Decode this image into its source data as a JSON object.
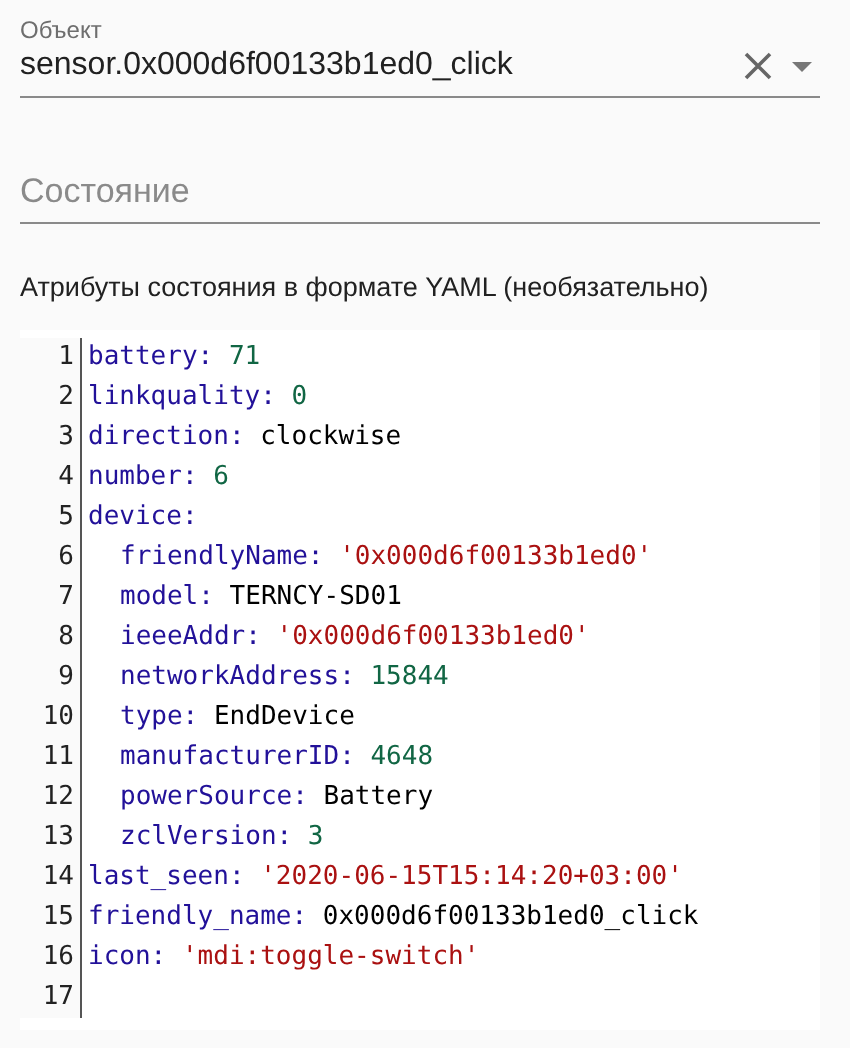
{
  "entity_field": {
    "label": "Объект",
    "value": "sensor.0x000d6f00133b1ed0_click"
  },
  "state_field": {
    "placeholder": "Состояние"
  },
  "attributes_label": "Атрибуты состояния в формате YAML (необязательно)",
  "yaml_editor": {
    "lines": [
      {
        "number": "1",
        "key": "battery:",
        "value": "71",
        "kind": "number"
      },
      {
        "number": "2",
        "key": "linkquality:",
        "value": "0",
        "kind": "number"
      },
      {
        "number": "3",
        "key": "direction:",
        "value": "clockwise",
        "kind": "plain"
      },
      {
        "number": "4",
        "key": "number:",
        "value": "6",
        "kind": "number"
      },
      {
        "number": "5",
        "key": "device:",
        "kind": "map",
        "children": [
          {
            "number": "6",
            "key": "friendlyName:",
            "value": "'0x000d6f00133b1ed0'",
            "kind": "string"
          },
          {
            "number": "7",
            "key": "model:",
            "value": "TERNCY-SD01",
            "kind": "plain"
          },
          {
            "number": "8",
            "key": "ieeeAddr:",
            "value": "'0x000d6f00133b1ed0'",
            "kind": "string"
          },
          {
            "number": "9",
            "key": "networkAddress:",
            "value": "15844",
            "kind": "number"
          },
          {
            "number": "10",
            "key": "type:",
            "value": "EndDevice",
            "kind": "plain"
          },
          {
            "number": "11",
            "key": "manufacturerID:",
            "value": "4648",
            "kind": "number"
          },
          {
            "number": "12",
            "key": "powerSource:",
            "value": "Battery",
            "kind": "plain"
          },
          {
            "number": "13",
            "key": "zclVersion:",
            "value": "3",
            "kind": "number"
          }
        ]
      },
      {
        "number": "14",
        "key": "last_seen:",
        "value": "'2020-06-15T15:14:20+03:00'",
        "kind": "string"
      },
      {
        "number": "15",
        "key": "friendly_name:",
        "value": "0x000d6f00133b1ed0_click",
        "kind": "plain"
      },
      {
        "number": "16",
        "key": "icon:",
        "value": "'mdi:toggle-switch'",
        "kind": "string"
      },
      {
        "number": "17",
        "kind": "empty"
      }
    ]
  }
}
